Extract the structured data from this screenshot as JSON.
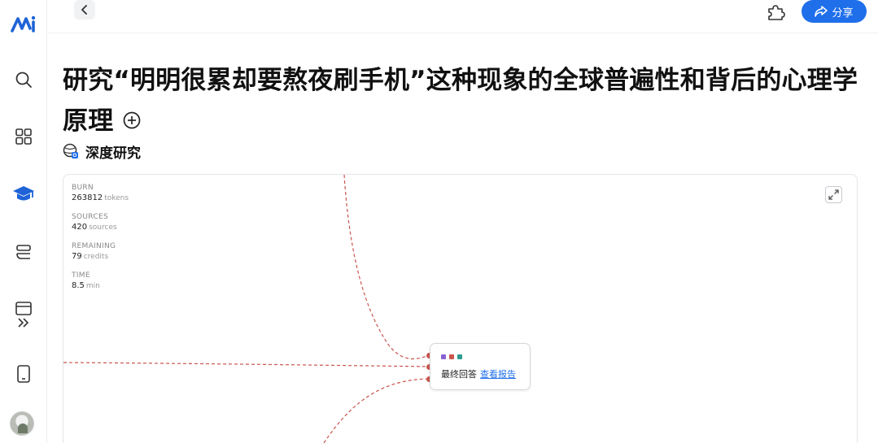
{
  "sidebar": {
    "items": [
      {
        "icon": "logo-icon"
      },
      {
        "icon": "search-icon"
      },
      {
        "icon": "apps-grid-icon"
      },
      {
        "icon": "graduation-cap-icon"
      },
      {
        "icon": "layers-icon"
      },
      {
        "icon": "window-icon"
      },
      {
        "icon": "double-chevron-right-icon"
      },
      {
        "icon": "mobile-icon"
      }
    ]
  },
  "topbar": {
    "share_label": "分享"
  },
  "page": {
    "title": "研究“明明很累却要熬夜刷手机”这种现象的全球普遍性和背后的心理学原理",
    "mode_label": "深度研究"
  },
  "stats": [
    {
      "label": "BURN",
      "value": "263812",
      "unit": "tokens"
    },
    {
      "label": "SOURCES",
      "value": "420",
      "unit": "sources"
    },
    {
      "label": "REMAINING",
      "value": "79",
      "unit": "credits"
    },
    {
      "label": "TIME",
      "value": "8.5",
      "unit": "min"
    }
  ],
  "final_node": {
    "label": "最终回答",
    "link": "查看报告",
    "dot_colors": [
      "#8a63d2",
      "#c9554e",
      "#2f9a8f"
    ]
  },
  "colors": {
    "accent": "#1f6feb",
    "link_line": "#c9554e"
  }
}
